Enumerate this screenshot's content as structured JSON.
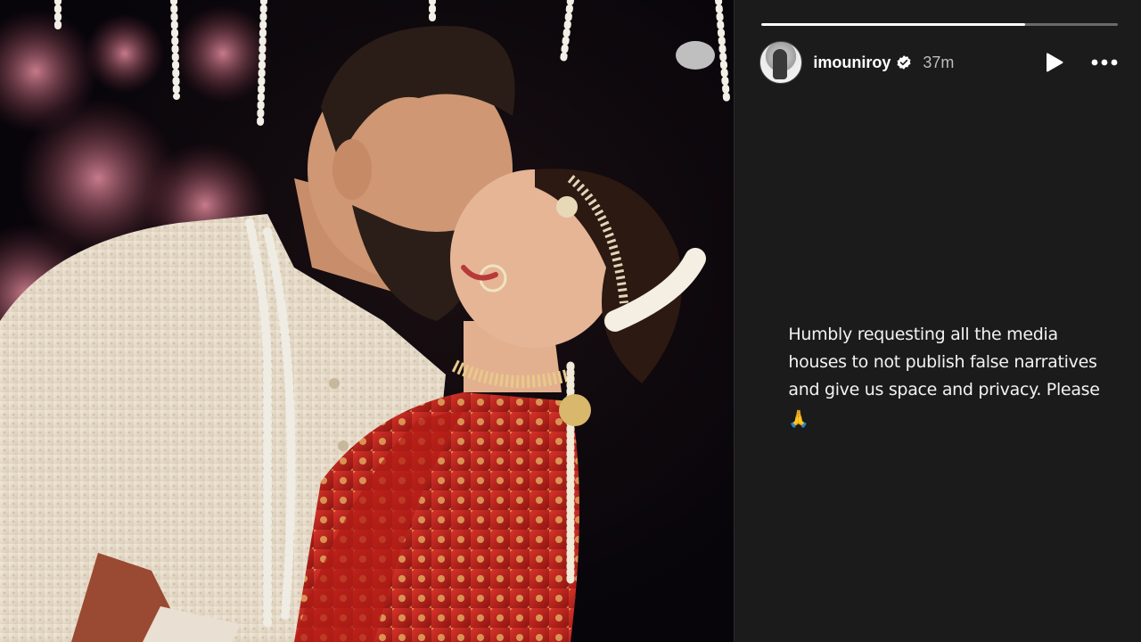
{
  "story": {
    "progress_percent": 74,
    "username": "imouniroy",
    "time_ago": "37m",
    "text": "Humbly requesting all the media houses to not publish false narratives and give us space and privacy. Please",
    "emoji": "🙏"
  },
  "colors": {
    "panel_bg": "#1b1b1c",
    "text": "#f2f2f2",
    "muted": "#bdbdbd",
    "verified_badge": "#ffffff"
  },
  "icons": {
    "verified": "verified-badge-icon",
    "play": "play-icon",
    "more": "more-options-icon"
  }
}
